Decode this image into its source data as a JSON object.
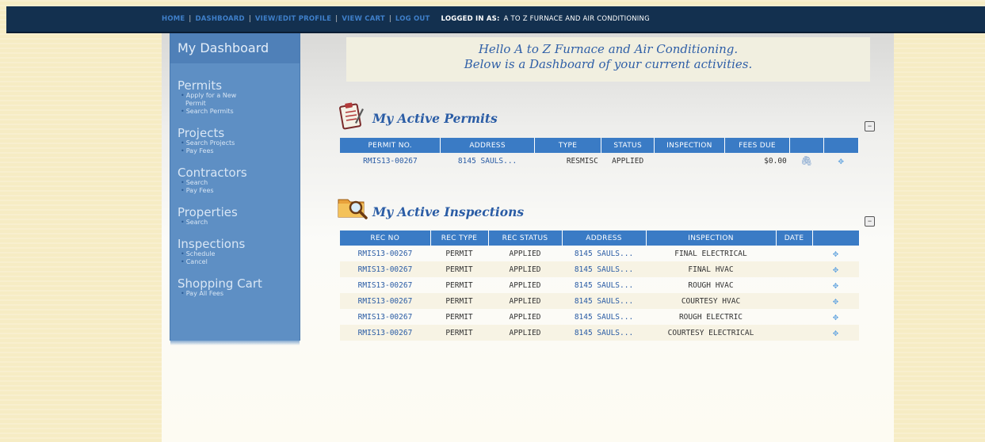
{
  "nav": {
    "items": [
      {
        "label": "HOME"
      },
      {
        "label": "DASHBOARD"
      },
      {
        "label": "VIEW/EDIT PROFILE"
      },
      {
        "label": "VIEW CART"
      },
      {
        "label": "LOG OUT"
      }
    ],
    "logged_in_label": "LOGGED IN AS:",
    "logged_in_name": "A TO Z FURNACE AND AIR CONDITIONING"
  },
  "sidebar": {
    "title": "My Dashboard",
    "sections": [
      {
        "heading": "Permits",
        "links": [
          "Apply for a New",
          "Permit",
          "Search Permits"
        ]
      },
      {
        "heading": "Projects",
        "links": [
          "Search Projects",
          "Pay Fees"
        ]
      },
      {
        "heading": "Contractors",
        "links": [
          "Search",
          "Pay Fees"
        ]
      },
      {
        "heading": "Properties",
        "links": [
          "Search"
        ]
      },
      {
        "heading": "Inspections",
        "links": [
          "Schedule",
          "Cancel"
        ]
      },
      {
        "heading": "Shopping Cart",
        "links": [
          "Pay All Fees"
        ]
      }
    ]
  },
  "greeting": {
    "line1": "Hello A to Z Furnace and Air Conditioning.",
    "line2": "Below is a Dashboard of your current activities."
  },
  "permits": {
    "title": "My Active Permits",
    "collapse_label": "−",
    "headers": [
      "PERMIT NO.",
      "ADDRESS",
      "TYPE",
      "STATUS",
      "INSPECTION",
      "FEES DUE",
      "",
      ""
    ],
    "rows": [
      {
        "permit_no": "RMIS13-00267",
        "address": "8145 SAULS...",
        "type": "RESMISC",
        "status": "APPLIED",
        "inspection": "",
        "fees_due": "$0.00"
      }
    ]
  },
  "inspections": {
    "title": "My Active Inspections",
    "collapse_label": "−",
    "headers": [
      "REC NO",
      "REC TYPE",
      "REC STATUS",
      "ADDRESS",
      "INSPECTION",
      "DATE",
      ""
    ],
    "rows": [
      {
        "rec_no": "RMIS13-00267",
        "rec_type": "PERMIT",
        "rec_status": "APPLIED",
        "address": "8145 SAULS...",
        "inspection": "FINAL ELECTRICAL",
        "date": ""
      },
      {
        "rec_no": "RMIS13-00267",
        "rec_type": "PERMIT",
        "rec_status": "APPLIED",
        "address": "8145 SAULS...",
        "inspection": "FINAL HVAC",
        "date": ""
      },
      {
        "rec_no": "RMIS13-00267",
        "rec_type": "PERMIT",
        "rec_status": "APPLIED",
        "address": "8145 SAULS...",
        "inspection": "ROUGH HVAC",
        "date": ""
      },
      {
        "rec_no": "RMIS13-00267",
        "rec_type": "PERMIT",
        "rec_status": "APPLIED",
        "address": "8145 SAULS...",
        "inspection": "COURTESY HVAC",
        "date": ""
      },
      {
        "rec_no": "RMIS13-00267",
        "rec_type": "PERMIT",
        "rec_status": "APPLIED",
        "address": "8145 SAULS...",
        "inspection": "ROUGH ELECTRIC",
        "date": ""
      },
      {
        "rec_no": "RMIS13-00267",
        "rec_type": "PERMIT",
        "rec_status": "APPLIED",
        "address": "8145 SAULS...",
        "inspection": "COURTESY ELECTRICAL",
        "date": ""
      }
    ]
  },
  "icons": {
    "attach": "paperclip-icon",
    "move": "move-icon",
    "permits_section": "clipboard-icon",
    "inspections_section": "magnifier-folder-icon"
  },
  "colors": {
    "topbar": "#13304f",
    "sidebar": "#5e8fc4",
    "table_header": "#3a7bc5",
    "link": "#2a5ca5"
  }
}
